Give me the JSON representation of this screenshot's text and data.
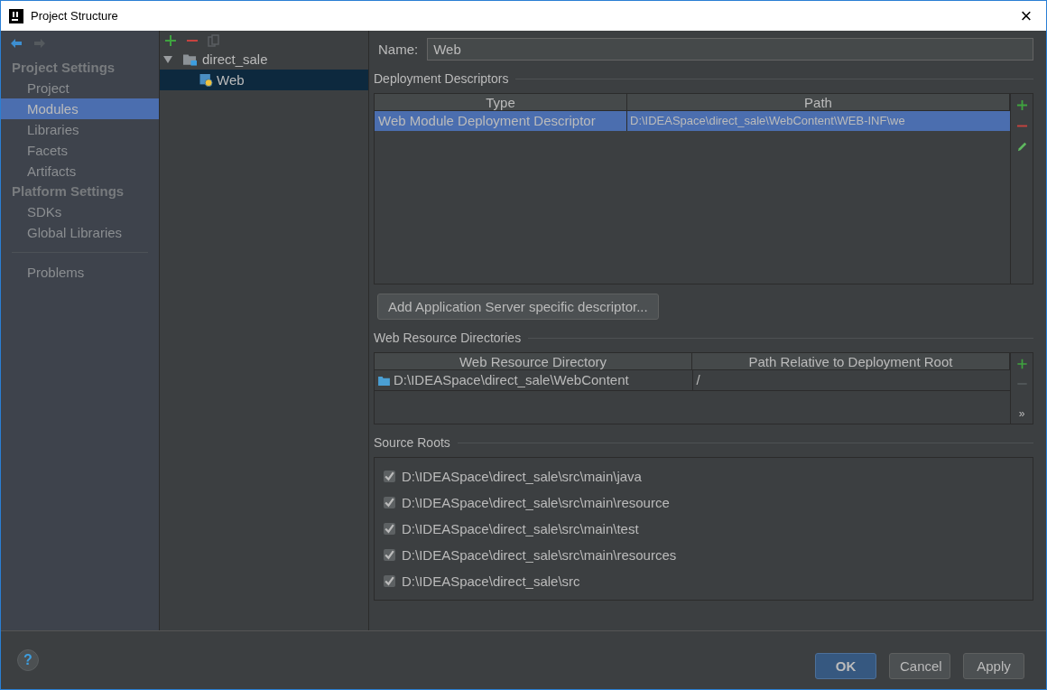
{
  "window": {
    "title": "Project Structure",
    "close": "×"
  },
  "sidebar": {
    "groups": [
      {
        "title": "Project Settings",
        "items": [
          {
            "label": "Project",
            "selected": false
          },
          {
            "label": "Modules",
            "selected": true
          },
          {
            "label": "Libraries",
            "selected": false
          },
          {
            "label": "Facets",
            "selected": false
          },
          {
            "label": "Artifacts",
            "selected": false
          }
        ]
      },
      {
        "title": "Platform Settings",
        "items": [
          {
            "label": "SDKs",
            "selected": false
          },
          {
            "label": "Global Libraries",
            "selected": false
          }
        ]
      }
    ],
    "bottom_items": [
      {
        "label": "Problems",
        "selected": false
      }
    ]
  },
  "tree": {
    "items": [
      {
        "label": "direct_sale",
        "expanded": true,
        "selected": false,
        "children": [
          {
            "label": "Web",
            "selected": true
          }
        ]
      }
    ]
  },
  "name_field": {
    "label": "Name:",
    "value": "Web"
  },
  "deployment_descriptors": {
    "title": "Deployment Descriptors",
    "columns": [
      "Type",
      "Path"
    ],
    "rows": [
      {
        "cells": [
          "Web Module Deployment Descriptor",
          "D:\\IDEASpace\\direct_sale\\WebContent\\WEB-INF\\we"
        ],
        "selected": true
      }
    ],
    "add_button": "Add Application Server specific descriptor..."
  },
  "web_resource_directories": {
    "title": "Web Resource Directories",
    "columns": [
      "Web Resource Directory",
      "Path Relative to Deployment Root"
    ],
    "rows": [
      {
        "cells": [
          "D:\\IDEASpace\\direct_sale\\WebContent",
          "/"
        ],
        "selected": false
      }
    ],
    "more": "»"
  },
  "source_roots": {
    "title": "Source Roots",
    "items": [
      {
        "label": "D:\\IDEASpace\\direct_sale\\src\\main\\java",
        "checked": true
      },
      {
        "label": "D:\\IDEASpace\\direct_sale\\src\\main\\resource",
        "checked": true
      },
      {
        "label": "D:\\IDEASpace\\direct_sale\\src\\main\\test",
        "checked": true
      },
      {
        "label": "D:\\IDEASpace\\direct_sale\\src\\main\\resources",
        "checked": true
      },
      {
        "label": "D:\\IDEASpace\\direct_sale\\src",
        "checked": true
      }
    ]
  },
  "footer": {
    "help": "?",
    "buttons": [
      {
        "label": "OK",
        "kind": "default"
      },
      {
        "label": "Cancel",
        "kind": "normal"
      },
      {
        "label": "Apply",
        "kind": "normal"
      }
    ]
  }
}
